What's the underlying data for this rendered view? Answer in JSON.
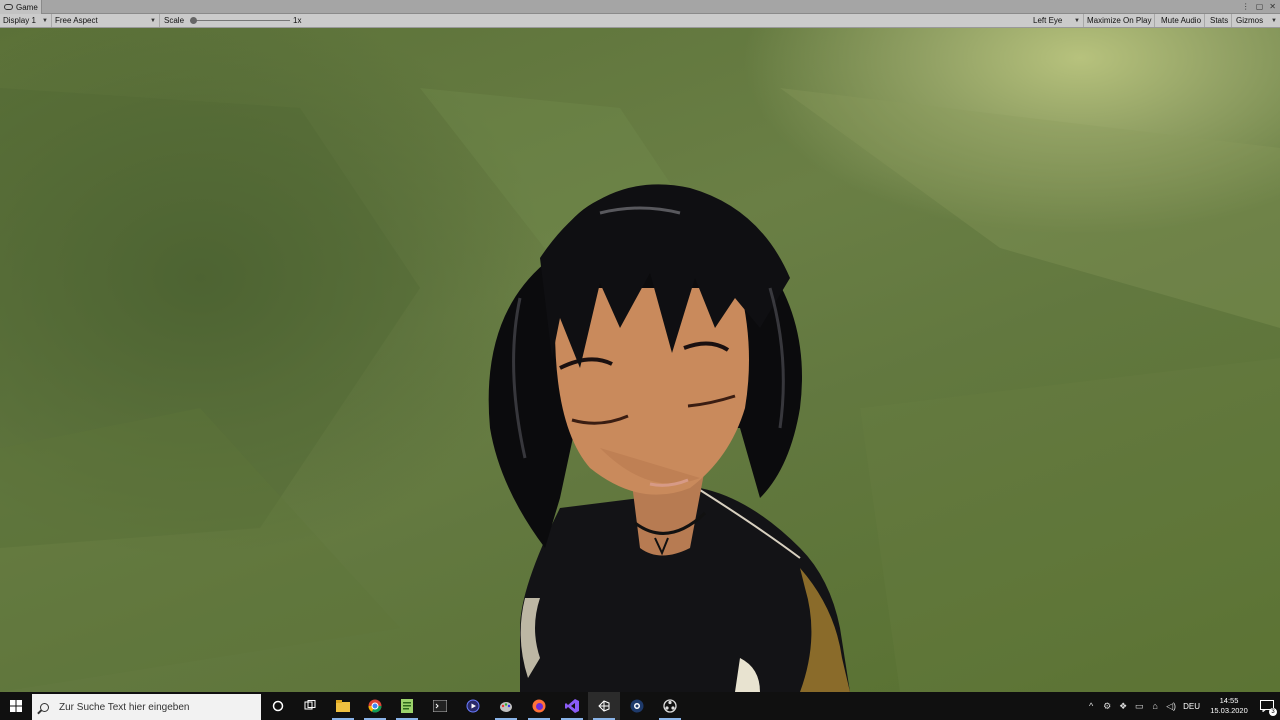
{
  "window": {
    "tab_title": "Game"
  },
  "toolbar": {
    "display": "Display 1",
    "aspect": "Free Aspect",
    "scale_label": "Scale",
    "scale_value": "1x",
    "eye": "Left Eye",
    "maximize": "Maximize On Play",
    "mute": "Mute Audio",
    "stats": "Stats",
    "gizmos": "Gizmos"
  },
  "taskbar": {
    "search_placeholder": "Zur Suche Text hier eingeben",
    "apps": [
      "cortana-icon",
      "task-view-icon",
      "file-explorer-icon",
      "chrome-icon",
      "notepad-plus-icon",
      "terminal-icon",
      "media-player-icon",
      "paint-icon",
      "firefox-icon",
      "visual-studio-icon",
      "unity-icon",
      "steam-like-icon",
      "obs-icon"
    ],
    "language": "DEU",
    "time": "14:55",
    "date": "15.03.2020",
    "notification_count": "3"
  },
  "colors": {
    "unity_chrome": "#cbcbcb",
    "taskbar": "#101010",
    "background_green": "#62783f",
    "visual_studio": "#8b5cf6"
  }
}
